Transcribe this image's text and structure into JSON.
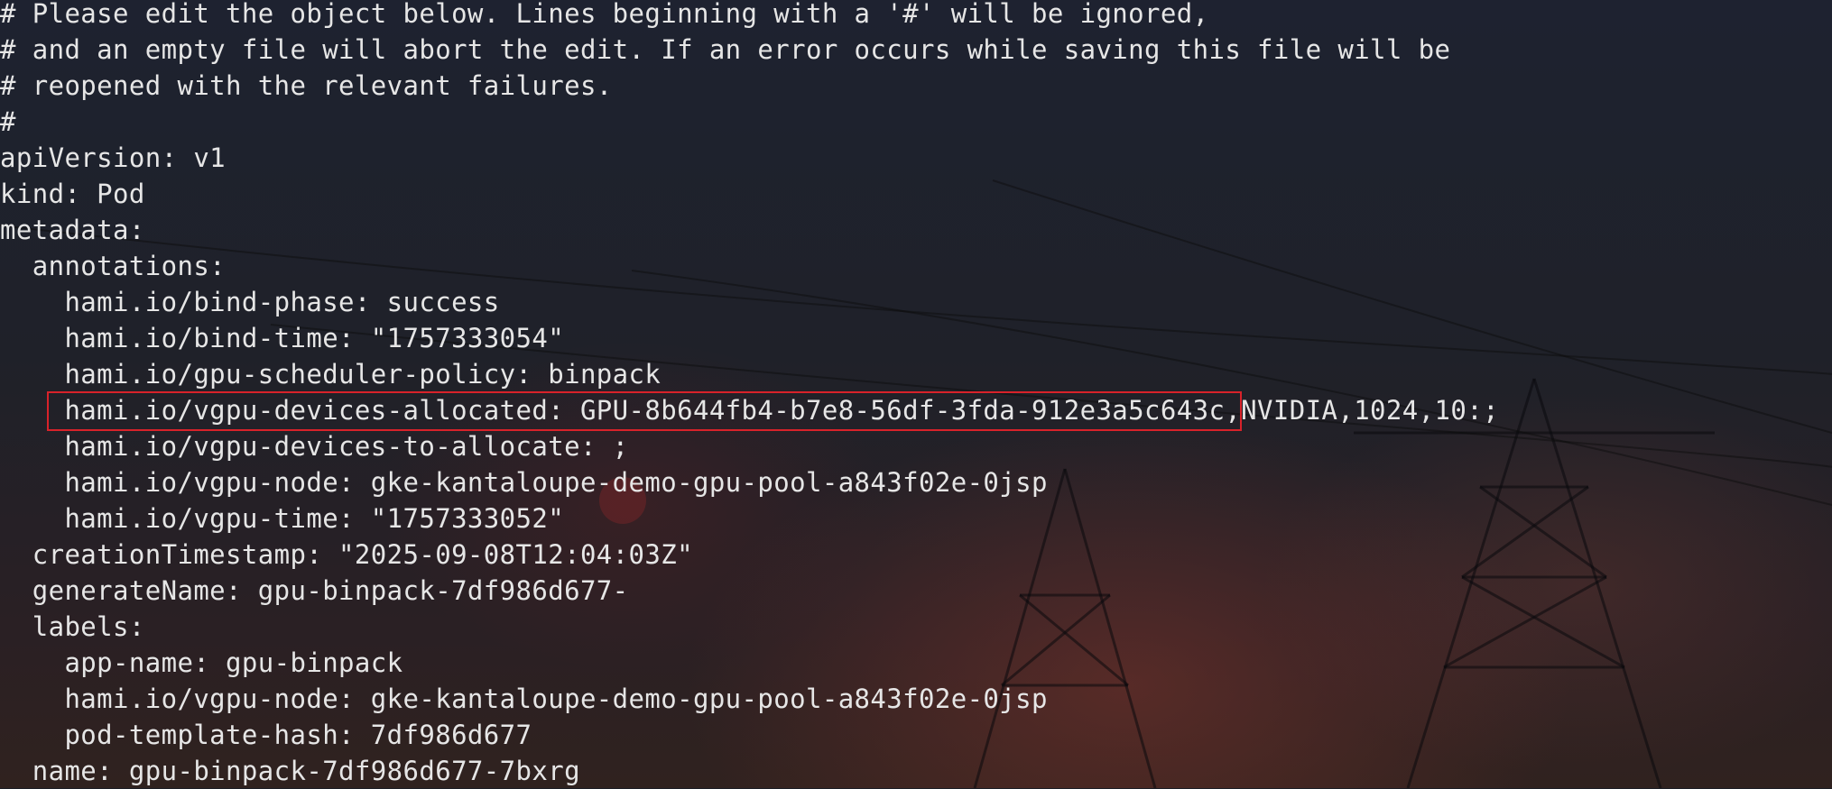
{
  "terminal": {
    "lines": [
      "# Please edit the object below. Lines beginning with a '#' will be ignored,",
      "# and an empty file will abort the edit. If an error occurs while saving this file will be",
      "# reopened with the relevant failures.",
      "#",
      "apiVersion: v1",
      "kind: Pod",
      "metadata:",
      "  annotations:",
      "    hami.io/bind-phase: success",
      "    hami.io/bind-time: \"1757333054\"",
      "    hami.io/gpu-scheduler-policy: binpack",
      "    hami.io/vgpu-devices-allocated: GPU-8b644fb4-b7e8-56df-3fda-912e3a5c643c,NVIDIA,1024,10:;",
      "    hami.io/vgpu-devices-to-allocate: ;",
      "    hami.io/vgpu-node: gke-kantaloupe-demo-gpu-pool-a843f02e-0jsp",
      "    hami.io/vgpu-time: \"1757333052\"",
      "  creationTimestamp: \"2025-09-08T12:04:03Z\"",
      "  generateName: gpu-binpack-7df986d677-",
      "  labels:",
      "    app-name: gpu-binpack",
      "    hami.io/vgpu-node: gke-kantaloupe-demo-gpu-pool-a843f02e-0jsp",
      "    pod-template-hash: 7df986d677",
      "  name: gpu-binpack-7df986d677-7bxrg"
    ]
  },
  "colors": {
    "text": "#e6e6e6",
    "highlight_border": "#d8222a",
    "background": "#1c1f27"
  }
}
